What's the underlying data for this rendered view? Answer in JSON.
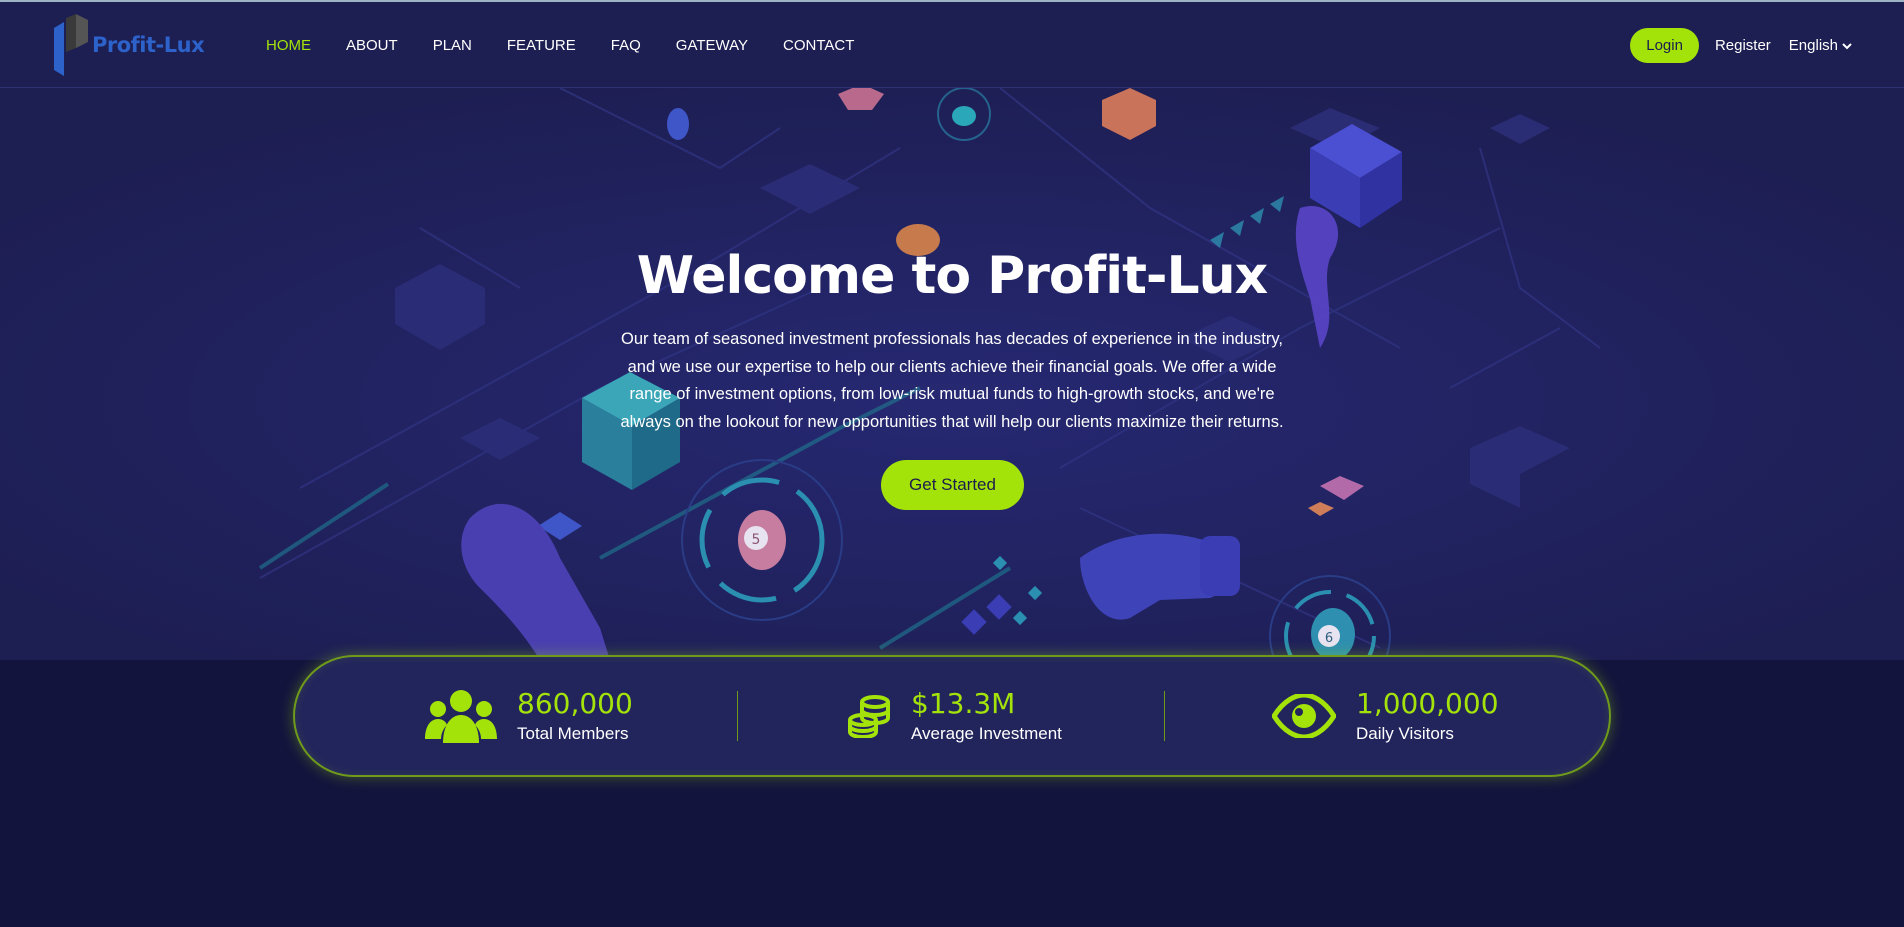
{
  "header": {
    "logo_text": "Profit-Lux",
    "nav": [
      {
        "label": "HOME",
        "active": true
      },
      {
        "label": "ABOUT",
        "active": false
      },
      {
        "label": "PLAN",
        "active": false
      },
      {
        "label": "FEATURE",
        "active": false
      },
      {
        "label": "FAQ",
        "active": false
      },
      {
        "label": "GATEWAY",
        "active": false
      },
      {
        "label": "CONTACT",
        "active": false
      }
    ],
    "login_label": "Login",
    "register_label": "Register",
    "language": "English"
  },
  "hero": {
    "title": "Welcome to Profit-Lux",
    "text": "Our team of seasoned investment professionals has decades of experience in the industry, and we use our expertise to help our clients achieve their financial goals. We offer a wide range of investment options, from low-risk mutual funds to high-growth stocks, and we're always on the lookout for new opportunities that will help our clients maximize their returns.",
    "cta_label": "Get Started"
  },
  "stats": [
    {
      "icon": "users-icon",
      "value": "860,000",
      "label": "Total Members"
    },
    {
      "icon": "coins-icon",
      "value": "$13.3M",
      "label": "Average Investment"
    },
    {
      "icon": "eye-icon",
      "value": "1,000,000",
      "label": "Daily Visitors"
    }
  ],
  "colors": {
    "accent": "#a4e30a",
    "header_bg": "#1d1e52",
    "page_bg": "#13143d",
    "logo_blue": "#2c62c9"
  }
}
